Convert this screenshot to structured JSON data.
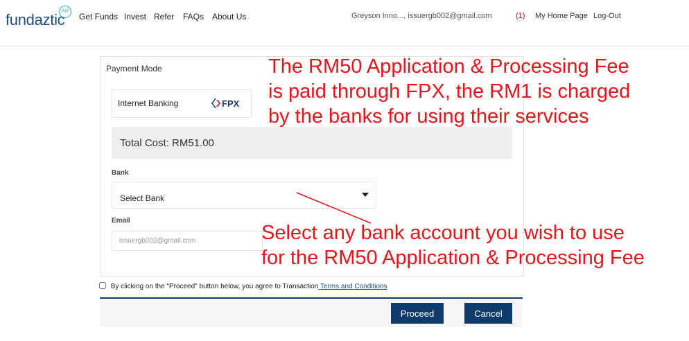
{
  "header": {
    "logo_text": "fundaztic",
    "logo_badge": "P2P",
    "nav": [
      {
        "label": "Get Funds"
      },
      {
        "label": "Invest"
      },
      {
        "label": "Refer"
      },
      {
        "label": "FAQs"
      },
      {
        "label": "About Us"
      }
    ],
    "user": "Greyson Inno..., issuergb002@gmail.com",
    "notifications": "(1)",
    "home_link": "My Home Page",
    "logout_link": "Log-Out"
  },
  "payment": {
    "title": "Payment Mode",
    "method_label": "Internet Banking",
    "method_logo": "FPX",
    "total_cost": "Total Cost: RM51.00",
    "bank_label": "Bank",
    "bank_value": "Select Bank",
    "email_label": "Email",
    "email_value": "issuergb002@gmail.com"
  },
  "agreement": {
    "text": "By clicking on the \"Proceed\" button below, you agree to Transaction",
    "link": " Terms and Conditions"
  },
  "buttons": {
    "proceed": "Proceed",
    "cancel": "Cancel"
  },
  "annotations": {
    "fee_note_lines": [
      "The RM50 Application & Processing Fee",
      "is paid through FPX, the RM1 is charged",
      "by the banks for using their services"
    ],
    "bank_note_lines": [
      "Select any bank account you wish to use",
      "for the RM50 Application & Processing Fee"
    ]
  },
  "colors": {
    "brand": "#1a4f86",
    "button": "#0e3b6b",
    "annotation": "#e8141c"
  }
}
